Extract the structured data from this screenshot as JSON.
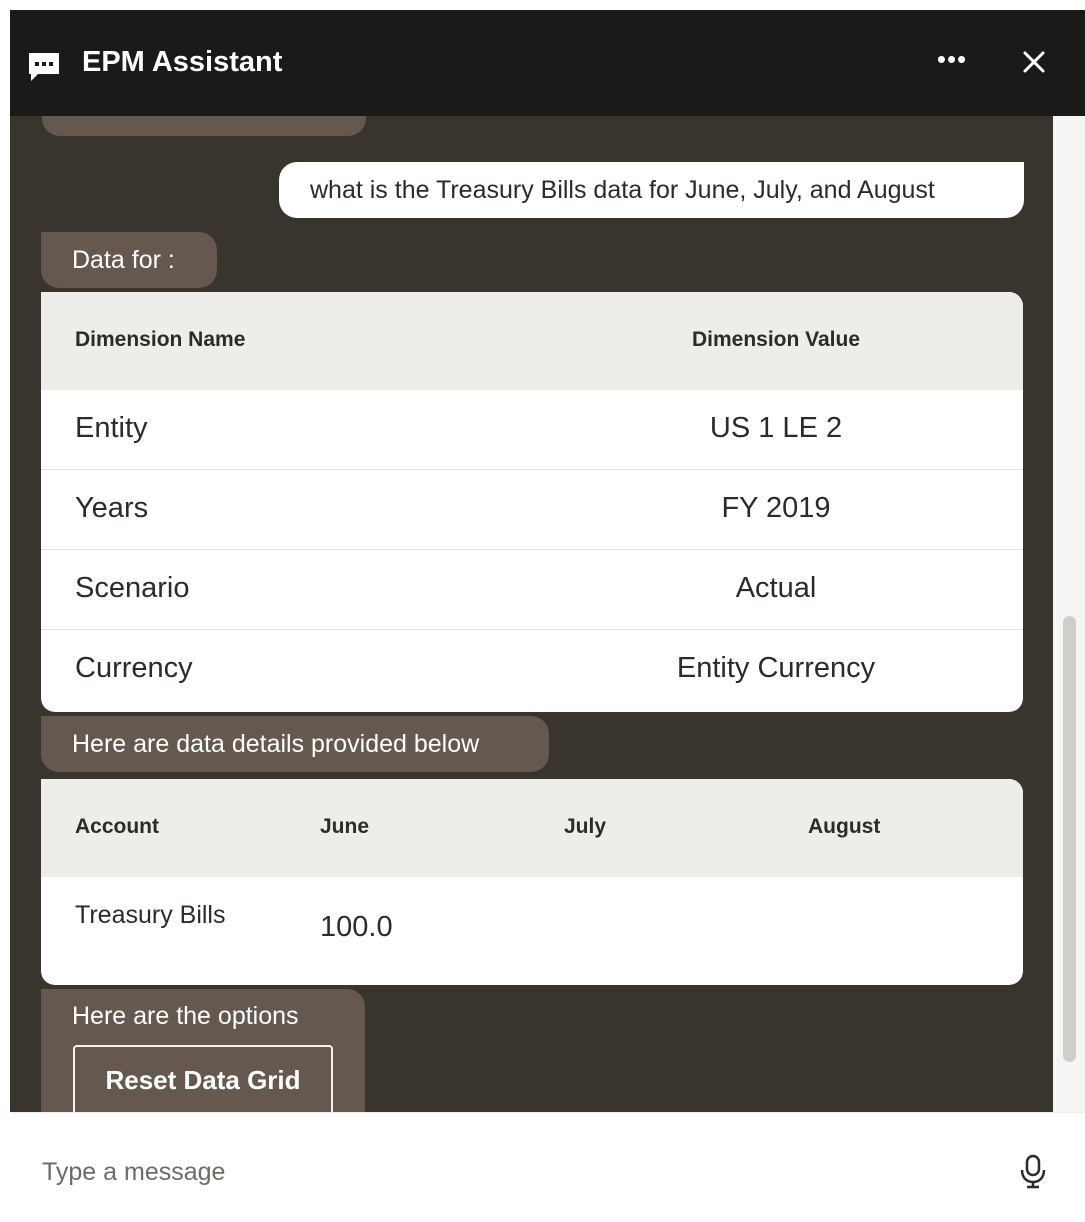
{
  "header": {
    "title": "EPM Assistant",
    "more_label": "•••"
  },
  "messages": {
    "user_query": "what is the Treasury Bills data for June, July, and August",
    "data_for_label": "Data for :",
    "details_label": "Here are data details provided below",
    "options_label": "Here are the options",
    "reset_button_label": "Reset Data Grid"
  },
  "dimensions_table": {
    "headers": [
      "Dimension Name",
      "Dimension Value"
    ],
    "rows": [
      [
        "Entity",
        "US 1 LE 2"
      ],
      [
        "Years",
        "FY 2019"
      ],
      [
        "Scenario",
        "Actual"
      ],
      [
        "Currency",
        "Entity Currency"
      ]
    ]
  },
  "accounts_table": {
    "headers": [
      "Account",
      "June",
      "July",
      "August"
    ],
    "rows": [
      [
        "Treasury Bills",
        "100.0",
        "",
        ""
      ]
    ]
  },
  "composer": {
    "placeholder": "Type a message"
  },
  "colors": {
    "header_bg": "#1b1a19",
    "conversation_bg": "#3a342f",
    "bot_bubble_bg": "#65594f",
    "table_header_bg": "#ededea"
  },
  "icons": {
    "chat": "chat-bubble-icon",
    "more": "more-horizontal-icon",
    "close": "close-icon",
    "mic": "microphone-icon"
  }
}
